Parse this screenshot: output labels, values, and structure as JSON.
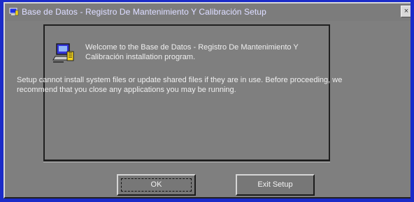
{
  "window": {
    "title": "Base de Datos - Registro De Mantenimiento Y Calibración Setup",
    "close_label": "×"
  },
  "content": {
    "welcome": "Welcome to the Base de Datos - Registro De Mantenimiento Y Calibración installation program.",
    "body": "Setup cannot install system files or update shared files if they are in use. Before proceeding, we recommend that you close any applications you may be running."
  },
  "buttons": {
    "ok": "OK",
    "exit": "Exit Setup"
  },
  "icons": {
    "title_icon": "setup-computer-icon",
    "app_icon": "installer-computer-icon"
  },
  "colors": {
    "desktop_blue": "#1b2bc8",
    "window_gray": "#7f7f7f",
    "title_text": "#d9d9ff"
  }
}
